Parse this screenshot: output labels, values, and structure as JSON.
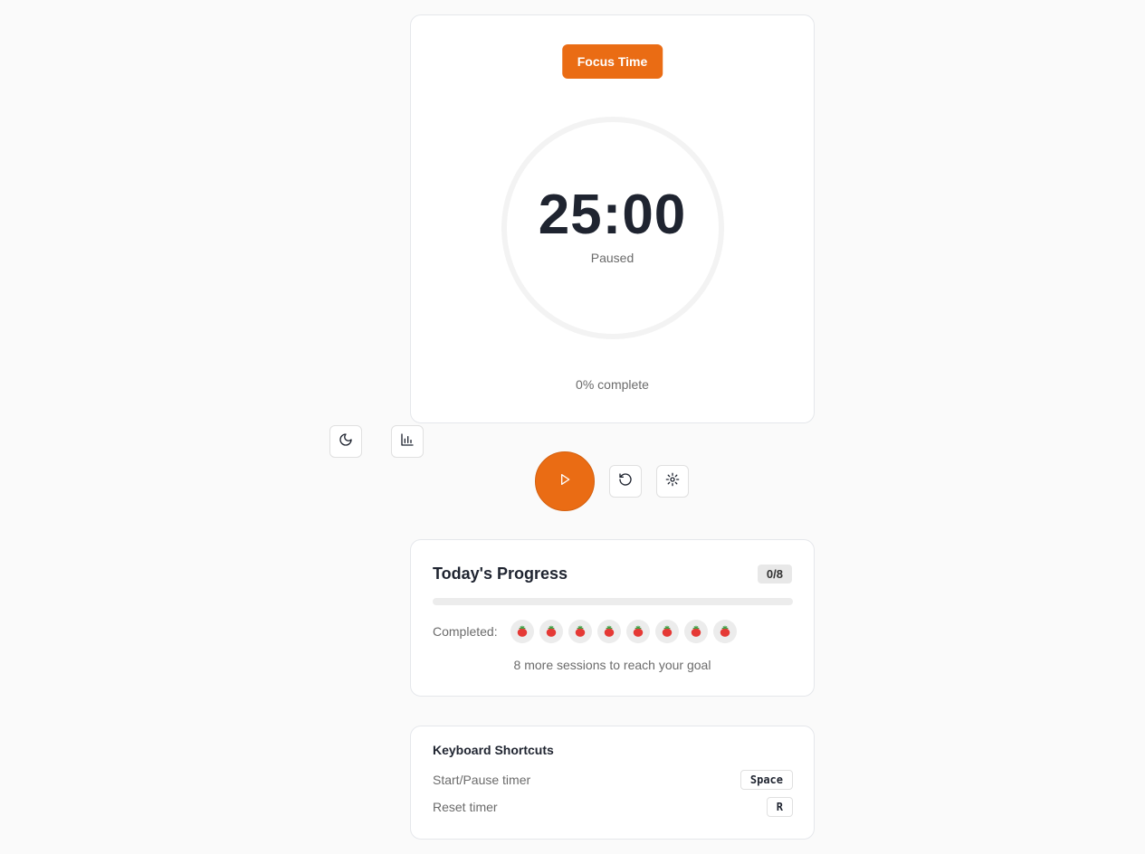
{
  "timer": {
    "mode_label": "Focus Time",
    "time": "25:00",
    "status": "Paused",
    "progress_fraction": 0,
    "complete_text": "0% complete"
  },
  "controls": {
    "theme_icon": "moon-icon",
    "stats_icon": "bar-chart-icon",
    "play_icon": "play-icon",
    "reset_icon": "rotate-ccw-icon",
    "settings_icon": "gear-icon"
  },
  "progress": {
    "title": "Today's Progress",
    "count": "0/8",
    "completed_fraction": 0,
    "completed_label": "Completed:",
    "session_icon": "tomato-icon",
    "session_count": 8,
    "remaining_text": "8 more sessions to reach your goal"
  },
  "shortcuts": {
    "title": "Keyboard Shortcuts",
    "items": [
      {
        "label": "Start/Pause timer",
        "key": "Space"
      },
      {
        "label": "Reset timer",
        "key": "R"
      }
    ]
  },
  "colors": {
    "accent": "#ea6c14",
    "background": "#fafafa",
    "card": "#ffffff"
  }
}
